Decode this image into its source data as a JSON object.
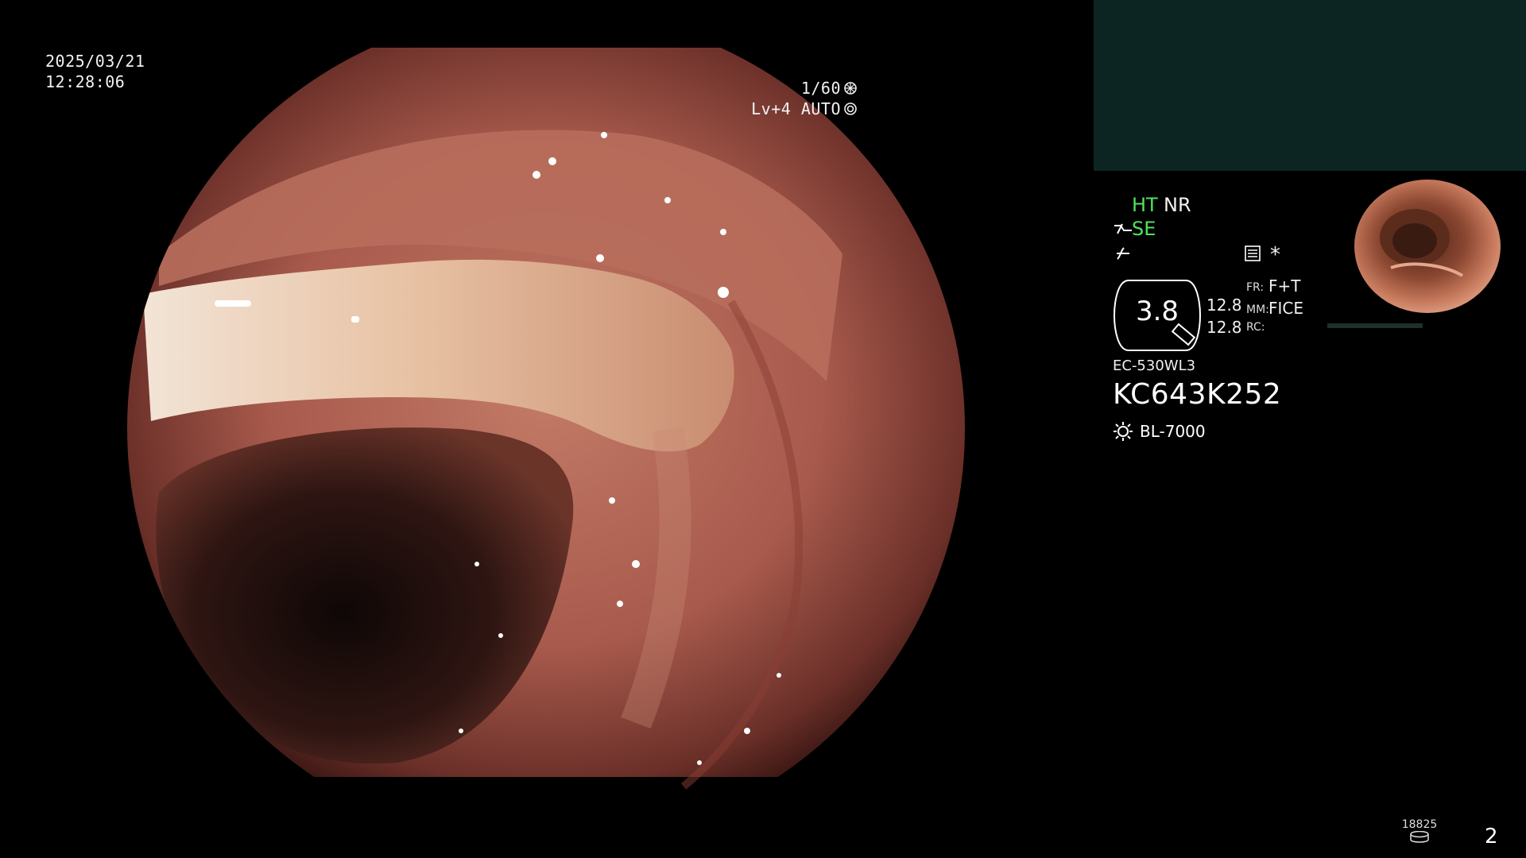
{
  "osd": {
    "date": "2025/03/21",
    "time": "12:28:06",
    "shutter": "1/60",
    "level": "Lv+4 AUTO"
  },
  "panel": {
    "ht": "HT",
    "nr": "NR",
    "se": "SE",
    "dial_value": "3.8",
    "val1": "12.8",
    "val2": "12.8",
    "fr_label": "FR:",
    "fr_value": "F+T",
    "mm_label": "MM:",
    "mm_value": "FICE",
    "rc_label": "RC:",
    "star": "*",
    "scope_model": "EC-530WL3",
    "scope_serial": "KC643K252",
    "light_source": "BL-7000"
  },
  "footer": {
    "counter": "18825",
    "page": "2"
  },
  "colors": {
    "mode_active": "#4fe35d",
    "teal_box": "#0c2522"
  },
  "icons": [
    "aperture-icon",
    "iris-icon",
    "scope-tip-icon",
    "edge-enhance-icon",
    "menu-icon",
    "lamp-icon",
    "disk-icon"
  ]
}
